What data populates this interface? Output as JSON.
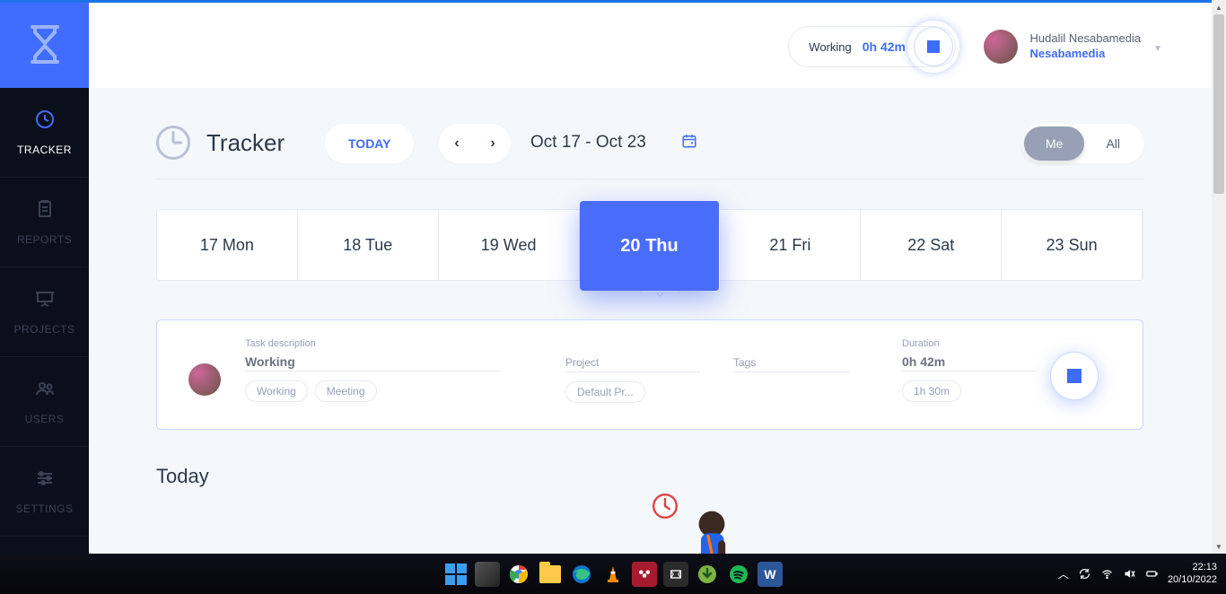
{
  "sidebar": {
    "items": [
      {
        "label": "TRACKER",
        "icon": "clock-icon",
        "active": true
      },
      {
        "label": "REPORTS",
        "icon": "clipboard-icon",
        "active": false
      },
      {
        "label": "PROJECTS",
        "icon": "presentation-icon",
        "active": false
      },
      {
        "label": "USERS",
        "icon": "users-icon",
        "active": false
      },
      {
        "label": "SETTINGS",
        "icon": "sliders-icon",
        "active": false
      }
    ]
  },
  "header": {
    "timer_status": "Working",
    "timer_value": "0h 42m",
    "user_fullname": "Hudalil Nesabamedia",
    "user_company": "Nesabamedia"
  },
  "page": {
    "title": "Tracker",
    "today_button": "TODAY",
    "date_range": "Oct 17 - Oct 23",
    "segment_me": "Me",
    "segment_all": "All",
    "today_heading": "Today"
  },
  "days": [
    {
      "label": "17 Mon",
      "active": false
    },
    {
      "label": "18 Tue",
      "active": false
    },
    {
      "label": "19 Wed",
      "active": false
    },
    {
      "label": "20 Thu",
      "active": true
    },
    {
      "label": "21 Fri",
      "active": false
    },
    {
      "label": "22 Sat",
      "active": false
    },
    {
      "label": "23 Sun",
      "active": false
    }
  ],
  "card": {
    "task_label": "Task description",
    "task_value": "Working",
    "task_chips": [
      "Working",
      "Meeting"
    ],
    "project_label": "Project",
    "project_chips": [
      "Default Pr..."
    ],
    "tags_label": "Tags",
    "duration_label": "Duration",
    "duration_value": "0h 42m",
    "duration_chips": [
      "1h 30m"
    ]
  },
  "taskbar": {
    "apps": [
      "Start",
      "Task View",
      "Chrome",
      "Files",
      "Edge",
      "VLC",
      "Mendeley",
      "Video Editor",
      "IDM",
      "Spotify",
      "Word"
    ],
    "time": "22:13",
    "date": "20/10/2022"
  }
}
